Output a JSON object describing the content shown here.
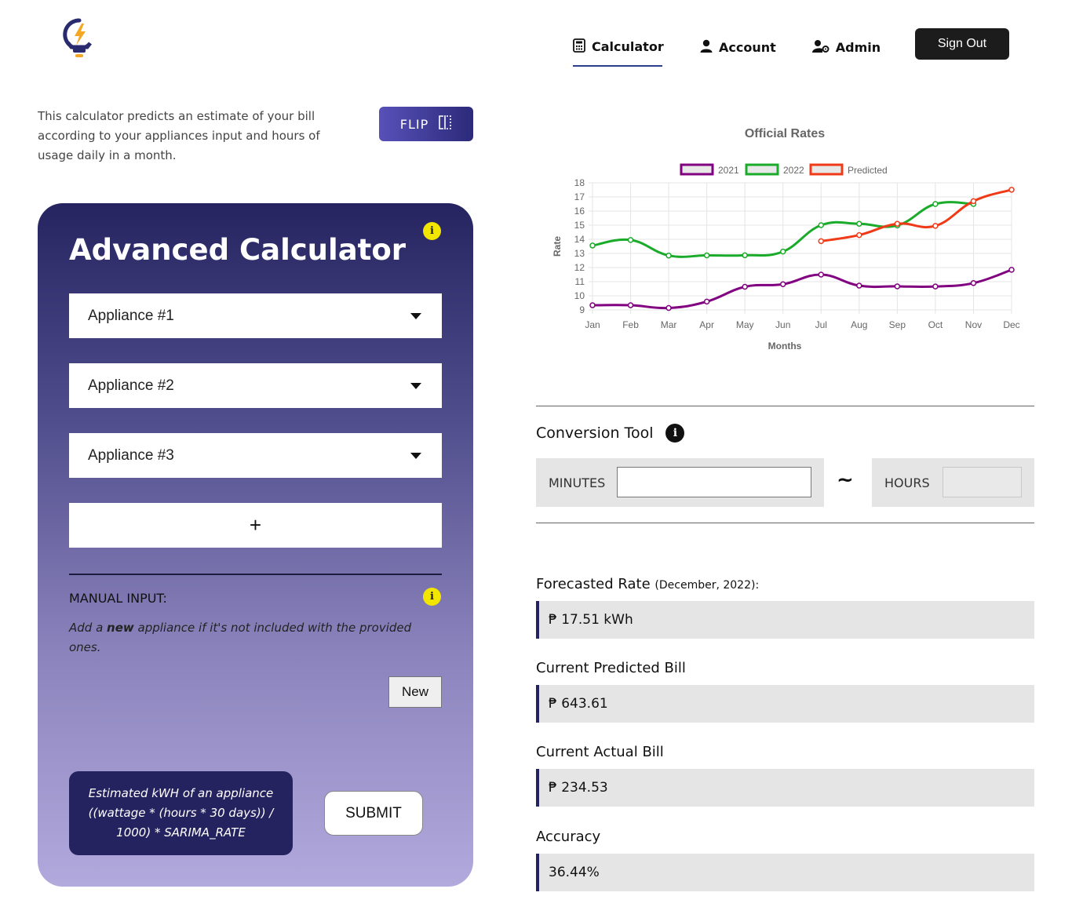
{
  "header": {
    "nav": {
      "calculator": "Calculator",
      "account": "Account",
      "admin": "Admin"
    },
    "sign_out": "Sign Out"
  },
  "intro": {
    "text": "This calculator predicts an estimate of your bill according to your appliances input and hours of usage daily in a month.",
    "flip_label": "FLIP"
  },
  "calculator": {
    "title": "Advanced Calculator",
    "appliances": [
      "Appliance #1",
      "Appliance #2",
      "Appliance #3"
    ],
    "add_label": "+",
    "manual_label": "MANUAL INPUT:",
    "manual_desc_pre": "Add a ",
    "manual_desc_bold": "new",
    "manual_desc_post": " appliance if it's not included with the provided ones.",
    "new_label": "New",
    "formula": "Estimated kWH of an appliance ((wattage * (hours * 30 days)) / 1000) * SARIMA_RATE",
    "submit_label": "SUBMIT"
  },
  "chart_data": {
    "type": "line",
    "title": "Official Rates",
    "xlabel": "Months",
    "ylabel": "Rate",
    "categories": [
      "Jan",
      "Feb",
      "Mar",
      "Apr",
      "May",
      "Jun",
      "Jul",
      "Aug",
      "Sep",
      "Oct",
      "Nov",
      "Dec"
    ],
    "ylim": [
      9,
      18
    ],
    "yticks": [
      9,
      10,
      11,
      12,
      13,
      14,
      15,
      16,
      17,
      18
    ],
    "legend_position": "top",
    "grid": true,
    "series": [
      {
        "name": "2021",
        "color": "#800080",
        "values": [
          9.33,
          9.33,
          9.14,
          9.59,
          10.64,
          10.82,
          11.5,
          10.72,
          10.67,
          10.66,
          10.9,
          11.84
        ]
      },
      {
        "name": "2022",
        "color": "#1aab2a",
        "values": [
          13.56,
          13.95,
          12.85,
          12.86,
          12.87,
          13.13,
          15.0,
          15.1,
          14.98,
          16.5,
          16.5,
          null
        ]
      },
      {
        "name": "Predicted",
        "color": "#f03a17",
        "values": [
          null,
          null,
          null,
          null,
          null,
          null,
          13.87,
          14.3,
          15.1,
          14.95,
          16.7,
          17.51
        ]
      }
    ]
  },
  "conversion": {
    "title": "Conversion Tool",
    "minutes_label": "MINUTES",
    "hours_label": "HOURS",
    "minutes_value": "",
    "hours_value": "",
    "separator": "~"
  },
  "results": {
    "forecast_label": "Forecasted Rate",
    "forecast_period": "(December, 2022):",
    "forecast_value": "₱ 17.51 kWh",
    "predicted_label": "Current Predicted Bill",
    "predicted_value": "₱ 643.61",
    "actual_label": "Current Actual Bill",
    "actual_value": "₱ 234.53",
    "accuracy_label": "Accuracy",
    "accuracy_value": "36.44%"
  }
}
